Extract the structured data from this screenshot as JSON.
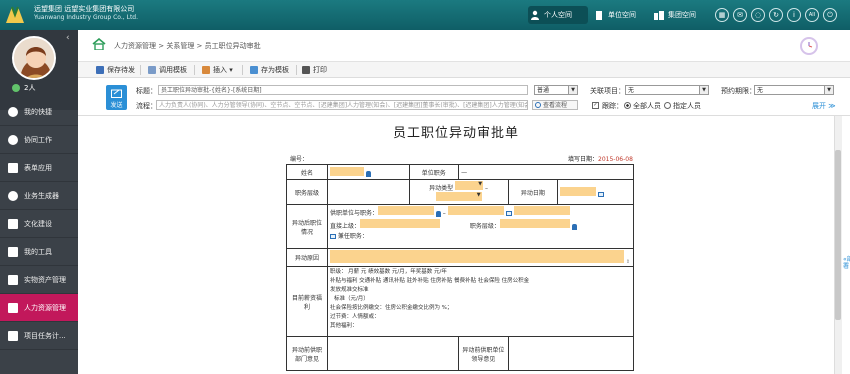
{
  "brand": {
    "line1": "远望集团   远望实业集团有限公司",
    "line2": "Yuanwang Industry Group Co., Ltd."
  },
  "top_tabs": [
    {
      "label": "个人空间"
    },
    {
      "label": "单位空间"
    },
    {
      "label": "集团空间"
    }
  ],
  "top_icons": [
    "grid-icon",
    "message-icon",
    "chat-icon",
    "refresh-icon",
    "info-icon",
    "all-icon",
    "power-icon"
  ],
  "top_icon_glyphs": [
    "▦",
    "✉",
    "◌",
    "↻",
    "i",
    "All",
    "⏻"
  ],
  "user": {
    "name": "2人"
  },
  "sidebar": [
    {
      "label": "我的快捷"
    },
    {
      "label": "协同工作"
    },
    {
      "label": "表单应用"
    },
    {
      "label": "业务生成器"
    },
    {
      "label": "文化建设"
    },
    {
      "label": "我的工具"
    },
    {
      "label": "实物资产管理"
    },
    {
      "label": "人力资源管理"
    },
    {
      "label": "项目任务计..."
    }
  ],
  "breadcrumb": "人力资源管理 > 关系管理 > 员工职位异动审批",
  "toolbar": {
    "save": "保存待发",
    "template": "调用模板",
    "insert": "插入",
    "save_template": "存为模板",
    "print": "打印"
  },
  "form": {
    "send": "发送",
    "subject_label": "标题：",
    "subject_value": "员工职位异动审批-{姓名}-[系统日期]",
    "priority": "普通",
    "related_label": "关联项目：",
    "related_value": "无",
    "deadline_label": "预约期限：",
    "deadline_value": "无",
    "flow_label": "流程：",
    "flow_value": "人力负责人(协同)、人力分管领导(协同)、空节点、空节点、[迟建集团]人力管理(知会)、[迟建集团]董事长(审批)、[迟建集团]人力管理(知会)",
    "view_flow": "查看流程",
    "track_label": "跟踪：",
    "track_all": "全部人员",
    "track_assigned": "指定人员",
    "expand": "展开 ≫"
  },
  "document": {
    "title": "员工职位异动审批单",
    "number_label": "编号：",
    "date_label": "填写日期：",
    "date_value": "2015-06-08",
    "name_label": "姓名",
    "unit_label": "单位职务",
    "unit_value": "—",
    "level_label": "职务层级",
    "change_type_label": "异动类型",
    "change_date_label": "异动日期",
    "after_label": "异动后职位情况",
    "after_unit": "供职单位与职务：",
    "after_superior": "直接上级：",
    "after_level": "职务层级：",
    "after_parttime": "兼任职务：",
    "reason_label": "异动原因",
    "salary_label": "目前薪资福利",
    "salary_line1": "职级：  月薪    元  绩效基数    元/月，年奖基数    元/年",
    "salary_line2": "补贴与福利    交通补贴    通讯补贴    驻外补贴    住房补贴    餐费补贴    社会保险    住房公积金",
    "salary_line3": "发放规准交标准",
    "salary_line4": "标准（元/月）",
    "salary_line5": "社会保险按比例缴交：住房公积金缴交比例为 %；",
    "salary_line6": "过节费：人情额或：",
    "salary_line7": "其他福利：",
    "pre_dept_label": "异动前供职部门意见",
    "pre_leader_label": "异动前供职单位领导意见"
  },
  "right_panel": {
    "label": "«部署"
  },
  "colors": {
    "topbar": "#0f5e66",
    "sidebar": "#3b4148",
    "active": "#c2185b",
    "highlight": "#fbd38e",
    "accent": "#2b8fd6"
  }
}
